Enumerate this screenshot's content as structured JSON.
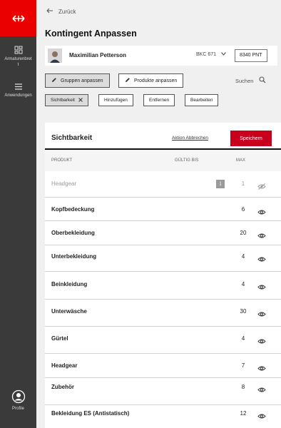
{
  "sidebar": {
    "items": [
      {
        "label": "Armaturenbrett",
        "icon": "dashboard-icon"
      },
      {
        "label": "Anwendungen",
        "icon": "menu-icon"
      },
      {
        "label": "Profile",
        "icon": "profile-icon"
      }
    ],
    "logo_icon": "sbb-logo-icon",
    "brand_color": "#eb0000"
  },
  "header": {
    "back_label": "Zurück",
    "title": "Kontingent Anpassen"
  },
  "user": {
    "name": "Maximilian Petterson",
    "account": "BKC 671",
    "points": "8340 PNT"
  },
  "toolbar": {
    "groups_label": "Gruppen anpassen",
    "products_label": "Produkte anpassen",
    "search_label": "Suchen"
  },
  "filters": {
    "selected_label": "Sichtbarkeit",
    "add_label": "Hinzufügen",
    "remove_label": "Entfernen",
    "edit_label": "Bearbeiten"
  },
  "panel": {
    "title": "Sichtbarkeit",
    "cancel_label": "Aktion Abbrechen",
    "save_label": "Speichern",
    "save_color": "#c8001e",
    "columns": {
      "product": "PRODUKT",
      "valid": "GÜLTIG BIS",
      "max": "MAX"
    },
    "rows": [
      {
        "name": "Headgear",
        "max": "1",
        "visible": false,
        "disabled": true,
        "info": true
      },
      {
        "name": "Kopfbedeckung",
        "max": "6",
        "visible": true
      },
      {
        "name": "Oberbekleidung",
        "max": "20",
        "visible": true
      },
      {
        "name": "Unterbekleidung",
        "max": "4",
        "visible": true
      },
      {
        "name": "Beinkleidung",
        "max": "4",
        "visible": true
      },
      {
        "name": "Unterwäsche",
        "max": "30",
        "visible": true
      },
      {
        "name": "Gürtel",
        "max": "4",
        "visible": true
      },
      {
        "name": "Headgear",
        "max": "7",
        "visible": true
      },
      {
        "name": "Zubehör",
        "max": "8",
        "visible": true
      },
      {
        "name": "Bekleidung ES (Antistatisch)",
        "max": "12",
        "visible": true
      }
    ]
  }
}
